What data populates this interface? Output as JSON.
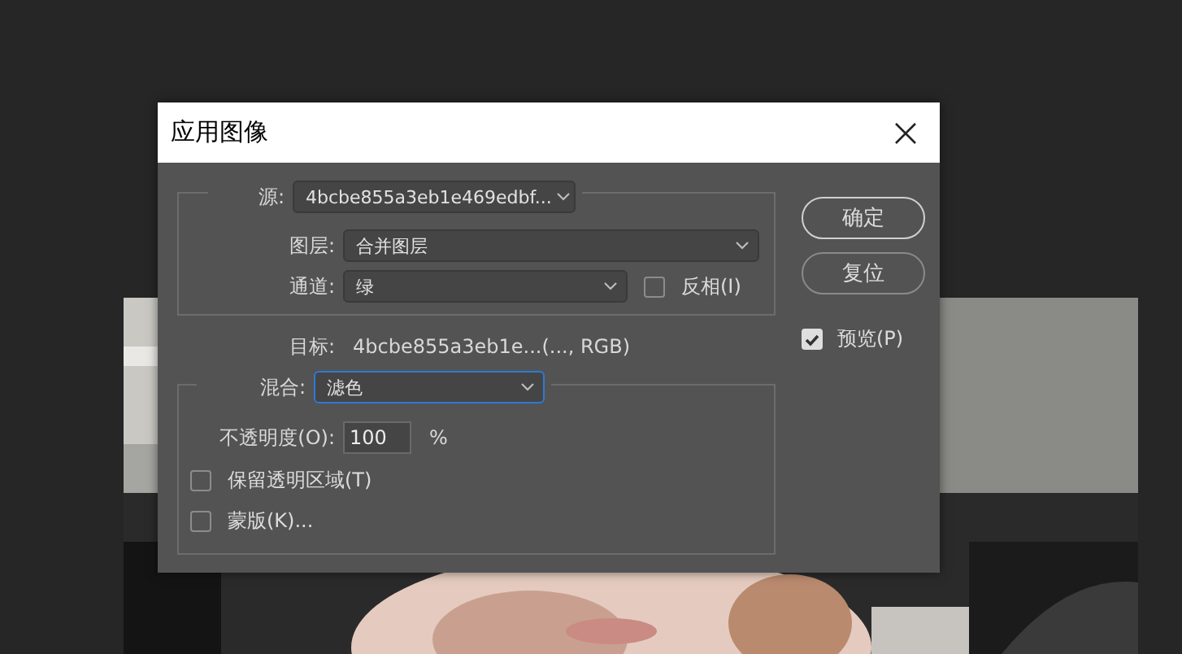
{
  "window": {
    "title": "应用图像"
  },
  "source": {
    "label": "源:",
    "value": "4bcbe855a3eb1e469edbf..."
  },
  "layer": {
    "label": "图层:",
    "value": "合并图层"
  },
  "channel": {
    "label": "通道:",
    "value": "绿"
  },
  "invert": {
    "label": "反相(I)",
    "checked": false
  },
  "target": {
    "label": "目标:",
    "value": "4bcbe855a3eb1e...(..., RGB)"
  },
  "blending": {
    "label": "混合:",
    "value": "滤色",
    "focused": true
  },
  "opacity": {
    "label": "不透明度(O):",
    "value": "100",
    "unit": "%"
  },
  "preserve_transparency": {
    "label": "保留透明区域(T)",
    "checked": false
  },
  "mask": {
    "label": "蒙版(K)...",
    "checked": false
  },
  "buttons": [
    {
      "label": "确定",
      "default": true
    },
    {
      "label": "复位",
      "default": false
    }
  ],
  "preview": {
    "label": "预览(P)",
    "checked": true
  }
}
